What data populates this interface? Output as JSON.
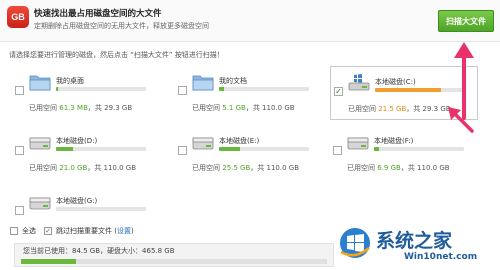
{
  "header": {
    "logo": "GB",
    "title": "快速找出最占用磁盘空间的大文件",
    "subtitle": "定期删除占用磁盘空间的无用大文件，释放更多磁盘空间",
    "scan_button": "扫描大文件"
  },
  "instruction": "请选择您要进行管理的磁盘，然后点击 “扫描大文件” 按钮进行扫描！",
  "usage_prefix": "已用空间",
  "usage_sep": "，共",
  "disks": [
    {
      "name": "我的桌面",
      "icon": "folder-icon",
      "used": "61.3 MB",
      "total": "29.3 GB",
      "used_fraction": 0.02,
      "checked": false
    },
    {
      "name": "我的文档",
      "icon": "folder-icon",
      "used": "5.1 GB",
      "total": "110.0 GB",
      "used_fraction": 0.05,
      "checked": false
    },
    {
      "name": "本地磁盘(C:)",
      "icon": "windows-drive-icon",
      "used": "21.5 GB",
      "total": "29.3 GB",
      "used_fraction": 0.73,
      "checked": true
    },
    {
      "name": "本地磁盘(D:)",
      "icon": "drive-icon",
      "used": "21.0 GB",
      "total": "110.0 GB",
      "used_fraction": 0.19,
      "checked": false
    },
    {
      "name": "本地磁盘(E:)",
      "icon": "drive-icon",
      "used": "25.5 GB",
      "total": "110.0 GB",
      "used_fraction": 0.23,
      "checked": false
    },
    {
      "name": "本地磁盘(F:)",
      "icon": "drive-icon",
      "used": "6.9 GB",
      "total": "110.0 GB",
      "used_fraction": 0.06,
      "checked": false
    },
    {
      "name": "本地磁盘(G:)",
      "icon": "drive-icon",
      "used": "",
      "total": "",
      "used_fraction": 0.0,
      "checked": false
    }
  ],
  "bottom": {
    "select_all": "全选",
    "skip_label": "跳过扫描重要文件 (",
    "settings_link": "设置",
    "skip_close": ")"
  },
  "status": {
    "text": "您当前已使用：84.5 GB，硬盘大小：465.8 GB",
    "used_fraction": 0.18
  },
  "watermark": {
    "title": "系统之家",
    "url": "Win10net.com"
  },
  "colors": {
    "accent_green": "#4ea528",
    "warn_orange": "#f0a030",
    "arrow_pink": "#e8336a",
    "brand_blue": "#1f5c9c"
  }
}
